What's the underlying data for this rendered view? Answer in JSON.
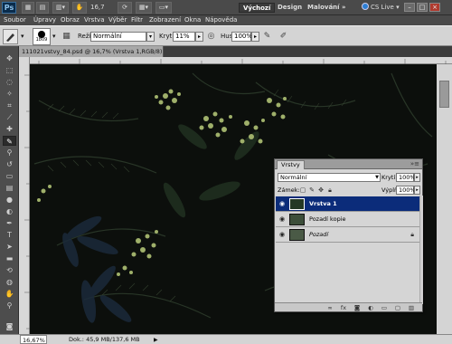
{
  "appbar": {
    "logo": "Ps",
    "zoom": "16,7",
    "workspaces": [
      "Výchozí",
      "Design",
      "Malování"
    ],
    "more": "»",
    "cs_live": "CS Live",
    "window_buttons": [
      "–",
      "□",
      "×"
    ]
  },
  "menubar": {
    "items": [
      "Soubor",
      "Úpravy",
      "Obraz",
      "Vrstva",
      "Výběr",
      "Filtr",
      "Zobrazení",
      "Okna",
      "Nápověda"
    ]
  },
  "options": {
    "brush_size": "1809",
    "mode_label": "Režim:",
    "mode_value": "Normální",
    "opacity_label": "Krytí:",
    "opacity_value": "11%",
    "flow_label": "Hust.:",
    "flow_value": "100%"
  },
  "document": {
    "tab_title": "111021vstvy_84.psd @ 16,7% (Vrstva 1,RGB/8) *",
    "tab_close": "×"
  },
  "status": {
    "zoom": "16,67%",
    "doc_info": "Dok.: 45,9 MB/137,6 MB",
    "arrow": "▶"
  },
  "layers_panel": {
    "tab": "Vrstvy",
    "menu": "»≡",
    "blend_mode": "Normální",
    "opacity_label": "Krytí:",
    "opacity_value": "100%",
    "lock_label": "Zámek:",
    "fill_label": "Výplň:",
    "fill_value": "100%",
    "layers": [
      {
        "name": "Vrstva 1",
        "selected": true,
        "locked": false
      },
      {
        "name": "Pozadí kopie",
        "selected": false,
        "locked": false
      },
      {
        "name": "Pozadí",
        "selected": false,
        "locked": true
      }
    ],
    "bottom_icons": [
      "link-icon",
      "fx-icon",
      "mask-icon",
      "adjustment-icon",
      "group-icon",
      "new-layer-icon",
      "trash-icon"
    ]
  },
  "colors": {
    "foreground": "#0f3f8c",
    "background": "#0a0a0a",
    "selected_layer": "#0b2c7a"
  }
}
